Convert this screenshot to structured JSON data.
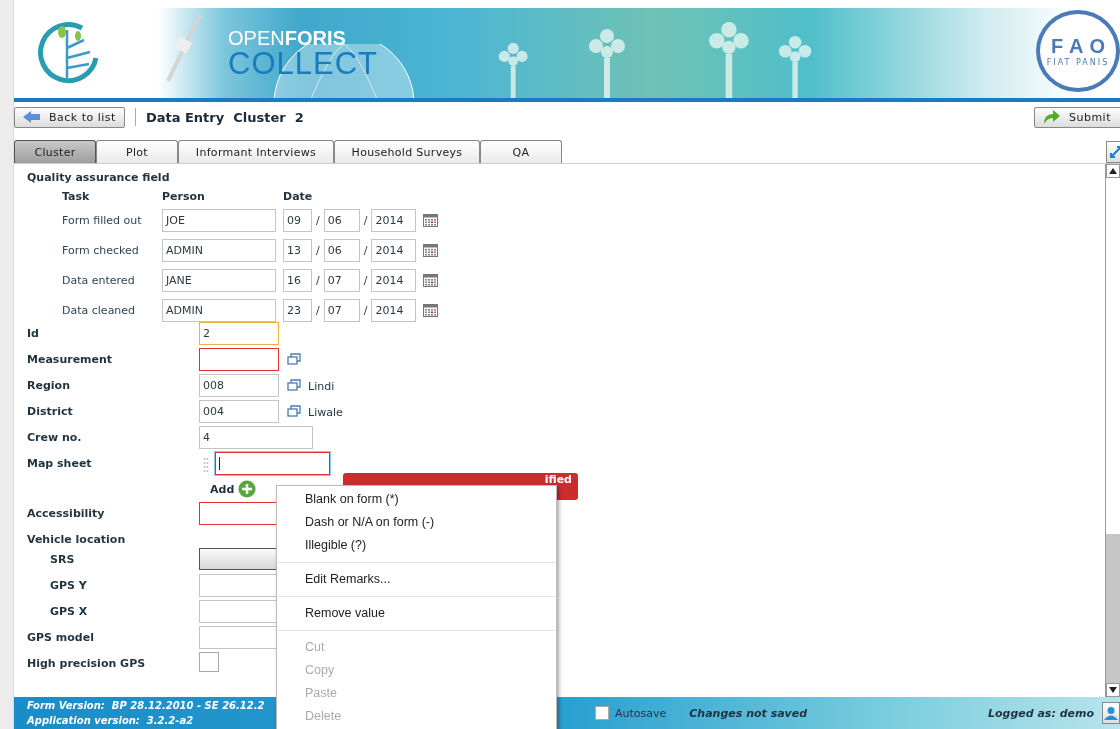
{
  "header": {
    "brand": "OPEN**FORIS**",
    "product": "COLLECT",
    "fao_letters": [
      "F",
      "A",
      "O"
    ],
    "fao_motto": "FIAT PANIS"
  },
  "toolbar": {
    "back": "Back to list",
    "title": "Data Entry  Cluster  2",
    "submit": "Submit"
  },
  "tabs": [
    {
      "label": "Cluster",
      "selected": true
    },
    {
      "label": "Plot",
      "selected": false
    },
    {
      "label": "Informant Interviews",
      "selected": false
    },
    {
      "label": "Household Surveys",
      "selected": false
    },
    {
      "label": "QA",
      "selected": false
    }
  ],
  "qa": {
    "title": "Quality assurance field",
    "columns": [
      "Task",
      "Person",
      "Date"
    ],
    "rows": [
      {
        "task": "Form filled out",
        "person": "JOE",
        "day": "09",
        "month": "06",
        "year": "2014"
      },
      {
        "task": "Form checked",
        "person": "ADMIN",
        "day": "13",
        "month": "06",
        "year": "2014"
      },
      {
        "task": "Data entered",
        "person": "JANE",
        "day": "16",
        "month": "07",
        "year": "2014"
      },
      {
        "task": "Data cleaned",
        "person": "ADMIN",
        "day": "23",
        "month": "07",
        "year": "2014"
      }
    ],
    "separator": "/"
  },
  "fields": [
    {
      "label": "Id",
      "kind": "text",
      "value": "2",
      "warning": true,
      "invalid": false
    },
    {
      "label": "Measurement",
      "kind": "code",
      "warning": false,
      "invalid": true
    },
    {
      "label": "Region",
      "kind": "code",
      "value": "008",
      "warning": false,
      "invalid": false,
      "description": "Lindi"
    },
    {
      "label": "District",
      "kind": "code",
      "value": "004",
      "warning": false,
      "invalid": false,
      "description": "Liwale"
    },
    {
      "label": "Crew no.",
      "kind": "wide",
      "value": "4",
      "warning": false,
      "invalid": false
    },
    {
      "label": "Map sheet",
      "kind": "multiple",
      "warning": false,
      "invalid": true,
      "add": "Add"
    },
    {
      "label": "Accessibility",
      "kind": "text",
      "warning": false,
      "invalid": true
    },
    {
      "label": "Vehicle location",
      "kind": "group"
    },
    {
      "label": "SRS",
      "kind": "select",
      "indent": true
    },
    {
      "label": "GPS Y",
      "kind": "text",
      "warning": false,
      "invalid": false,
      "indent": true
    },
    {
      "label": "GPS X",
      "kind": "text",
      "warning": false,
      "invalid": false,
      "indent": true
    },
    {
      "label": "GPS model",
      "kind": "text",
      "warning": false,
      "invalid": false
    },
    {
      "label": "High precision GPS",
      "kind": "checkbox",
      "checked": false
    }
  ],
  "error_tooltip": "ified",
  "context_menu": [
    {
      "kind": "item",
      "label": "Blank on form (*)",
      "disabled": false
    },
    {
      "kind": "item",
      "label": "Dash or N/A on form (-)",
      "disabled": false
    },
    {
      "kind": "item",
      "label": "Illegible (?)",
      "disabled": false
    },
    {
      "kind": "separator"
    },
    {
      "kind": "item",
      "label": "Edit Remarks...",
      "disabled": false
    },
    {
      "kind": "separator"
    },
    {
      "kind": "item",
      "label": "Remove value",
      "disabled": false
    },
    {
      "kind": "separator"
    },
    {
      "kind": "item",
      "label": "Cut",
      "disabled": true
    },
    {
      "kind": "item",
      "label": "Copy",
      "disabled": true
    },
    {
      "kind": "item",
      "label": "Paste",
      "disabled": true
    },
    {
      "kind": "item",
      "label": "Delete",
      "disabled": true
    }
  ],
  "status_bar": {
    "form_version": "Form Version:  BP 28.12.2010 - SE 26.12.2",
    "app_version": "Application version:  3.2.2-a2",
    "autosave": {
      "label": "Autosave",
      "checked": false
    },
    "save_state": "Changes not saved",
    "user": "Logged as: demo"
  }
}
